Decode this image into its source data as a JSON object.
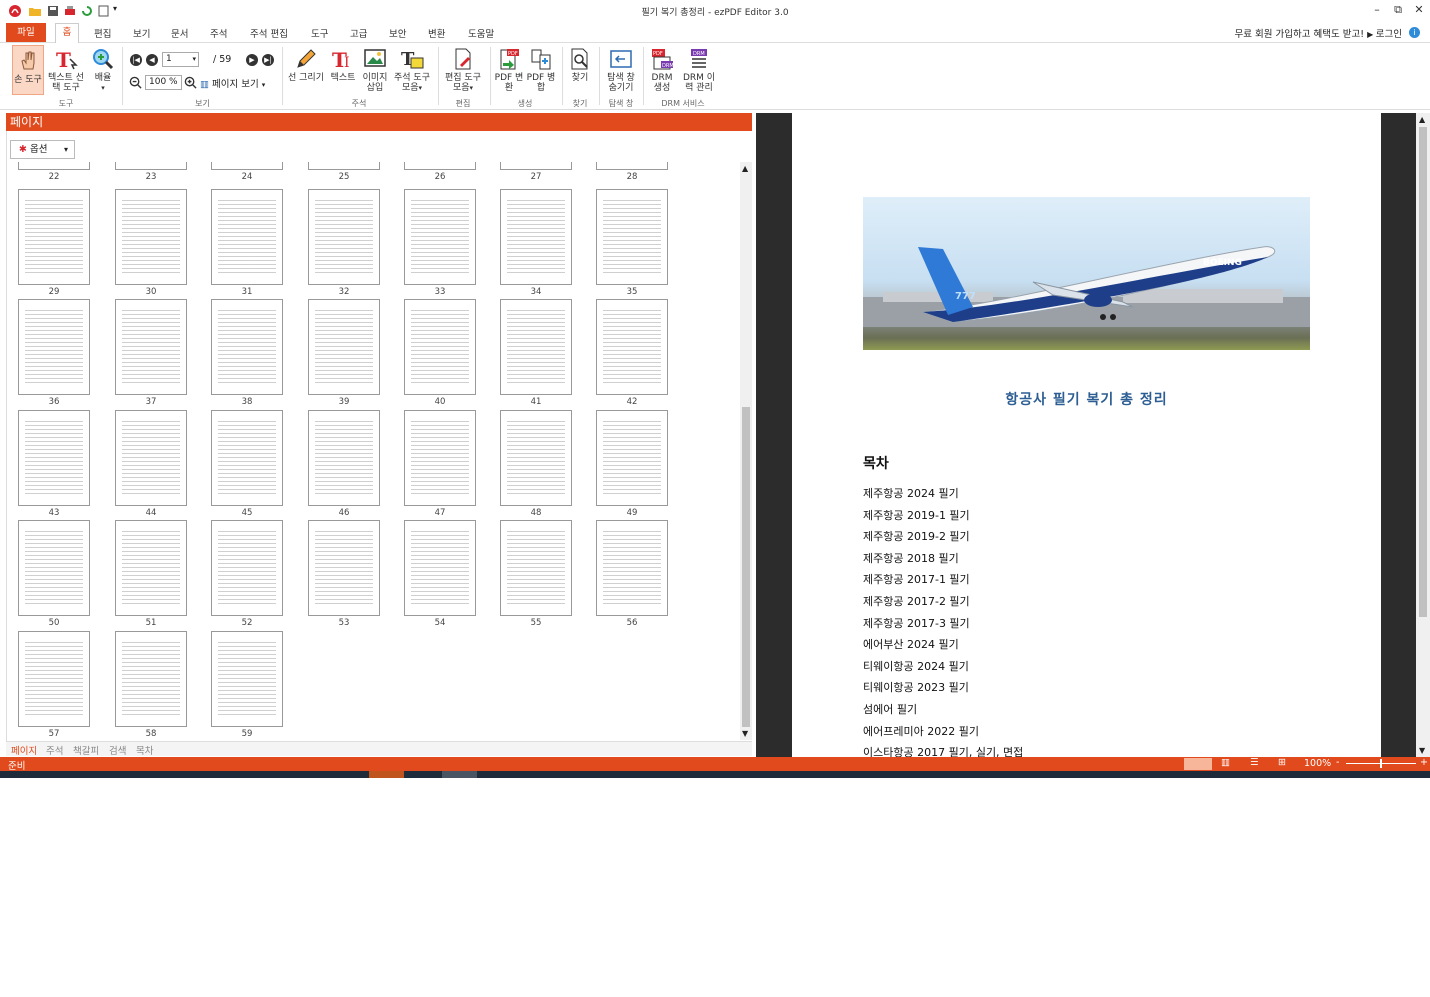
{
  "window": {
    "title": "필기 복기 총정리 - ezPDF Editor 3.0",
    "minimize": "–",
    "restore": "⧉",
    "close": "✕"
  },
  "menu": {
    "file": "파일",
    "items": [
      "홈",
      "편집",
      "보기",
      "문서",
      "주석",
      "주석 편집",
      "도구",
      "고급",
      "보안",
      "변환",
      "도움말"
    ],
    "promo": "무료 회원 가입하고 혜택도 받고!",
    "login": "로그인",
    "help": "i"
  },
  "ribbon": {
    "hand_tool": "손 도구",
    "text_select": "텍스트 선택 도구",
    "zoom_mag": "배율",
    "group_tool": "도구",
    "page_input": "1",
    "page_total": "/ 59",
    "zoom_input": "100 %",
    "page_view": "페이지 보기",
    "group_view": "보기",
    "line_draw": "선 그리기",
    "text": "텍스트",
    "image_insert": "이미지 삽입",
    "annot_tools": "주석 도구 모음",
    "group_annot": "주석",
    "edit_tools": "편집 도구 모음",
    "group_edit": "편집",
    "pdf_convert": "PDF 변환",
    "pdf_merge": "PDF 병합",
    "group_create": "생성",
    "find": "찾기",
    "group_find": "찾기",
    "explorer_hide": "탐색 창 숨기기",
    "group_explorer": "탐색 창",
    "drm_create": "DRM 생성",
    "drm_history": "DRM 이력 관리",
    "group_drm": "DRM 서비스"
  },
  "panel": {
    "title": "페이지",
    "options": "옵션",
    "top_numbers": [
      "22",
      "23",
      "24",
      "25",
      "26",
      "27",
      "28"
    ],
    "thumbnails": [
      [
        "29",
        "30",
        "31",
        "32",
        "33",
        "34",
        "35"
      ],
      [
        "36",
        "37",
        "38",
        "39",
        "40",
        "41",
        "42"
      ],
      [
        "43",
        "44",
        "45",
        "46",
        "47",
        "48",
        "49"
      ],
      [
        "50",
        "51",
        "52",
        "53",
        "54",
        "55",
        "56"
      ],
      [
        "57",
        "58",
        "59"
      ]
    ],
    "tabs": [
      "페이지",
      "주석",
      "책갈피",
      "검색",
      "목차"
    ]
  },
  "document": {
    "title": "항공사 필기 복기 총 정리",
    "toc_heading": "목차",
    "toc": [
      "제주항공 2024 필기",
      "제주항공 2019-1 필기",
      "제주항공 2019-2 필기",
      "제주항공 2018 필기",
      "제주항공 2017-1 필기",
      "제주항공 2017-2 필기",
      "제주항공 2017-3 필기",
      "에어부산 2024 필기",
      "티웨이항공 2024 필기",
      "티웨이항공 2023 필기",
      "섬에어 필기",
      "에어프레미아 2022 필기",
      "이스타항공 2017 필기, 실기, 면접"
    ],
    "plane_text": "BOEING",
    "plane_tail": "777"
  },
  "status": {
    "ready": "준비",
    "zoom": "100%",
    "minus": "-",
    "plus": "+"
  },
  "colors": {
    "accent": "#e04a1c",
    "doc_title": "#2d5e93"
  }
}
